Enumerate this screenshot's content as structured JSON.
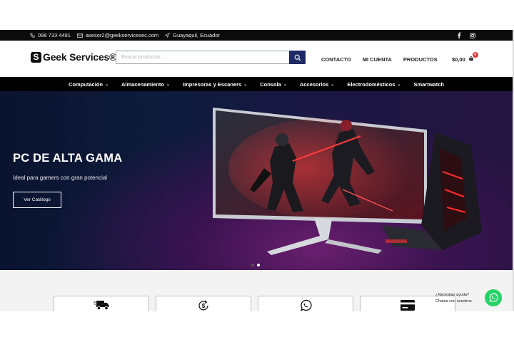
{
  "topbar": {
    "phone": "098 733 4491",
    "email": "asesor2@geekservicesec.com",
    "location": "Guayaquil, Ecuador",
    "social": [
      "facebook-icon",
      "instagram-icon"
    ]
  },
  "header": {
    "logo_text": "Geek Services®",
    "search_placeholder": "Buscar productos...",
    "nav": [
      "CONTACTO",
      "MI CUENTA",
      "PRODUCTOS"
    ],
    "cart_total": "$0,00",
    "cart_count": "0"
  },
  "categories": [
    {
      "label": "Computación",
      "has_dropdown": true
    },
    {
      "label": "Almacenamiento",
      "has_dropdown": true
    },
    {
      "label": "Impresoras y Escaners",
      "has_dropdown": true
    },
    {
      "label": "Consola",
      "has_dropdown": true
    },
    {
      "label": "Accesorios",
      "has_dropdown": true
    },
    {
      "label": "Electrodomésticos",
      "has_dropdown": true
    },
    {
      "label": "Smartwatch",
      "has_dropdown": false
    }
  ],
  "hero": {
    "title": "PC DE ALTA GAMA",
    "subtitle": "Ideal para gamers con gran potencial",
    "button": "Ver Catálogo",
    "slides": 2,
    "active_slide": 2
  },
  "features": {
    "cards": [
      {
        "icon": "delivery-truck-icon"
      },
      {
        "icon": "dollar-refresh-icon"
      },
      {
        "icon": "whatsapp-icon"
      },
      {
        "icon": "credit-card-icon"
      }
    ]
  },
  "chat": {
    "line1": "¿Necesitas ayuda?",
    "line2": "Chatea con nosotros"
  },
  "colors": {
    "accent": "#1e2a63",
    "topbar": "#0b0b0b",
    "whatsapp": "#25d366",
    "badge": "#e53935"
  }
}
